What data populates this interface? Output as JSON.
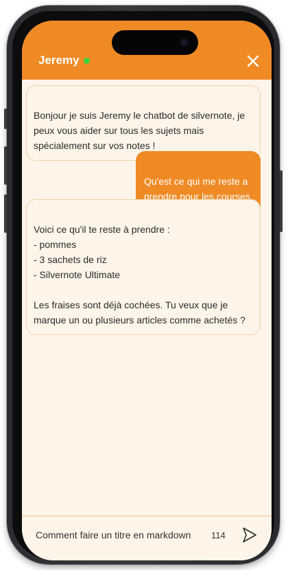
{
  "chat": {
    "bot_name": "Jeremy",
    "status": "online",
    "messages": [
      {
        "role": "bot",
        "text": "Bonjour je suis Jeremy le chatbot de silvernote, je peux vous aider sur tous les sujets mais spécialement sur vos notes !"
      },
      {
        "role": "user",
        "text": "Qu'est ce qui me reste a prendre pour les courses ?"
      },
      {
        "role": "bot",
        "text": "Voici ce qu'il te reste à prendre :\n- pommes\n- 3 sachets de riz\n- Silvernote Ultimate\n\nLes fraises sont déjà cochées. Tu veux que je marque un ou plusieurs articles comme achetés ?"
      }
    ]
  },
  "composer": {
    "value": "Comment faire un titre en markdown ?",
    "char_count": "114"
  },
  "icons": {
    "close": "close-icon",
    "send": "send-icon",
    "status": "online-status-dot"
  },
  "colors": {
    "accent": "#f08a25",
    "background": "#fdf4ea",
    "bot_border": "#efd4a8",
    "online": "#36d43a"
  }
}
